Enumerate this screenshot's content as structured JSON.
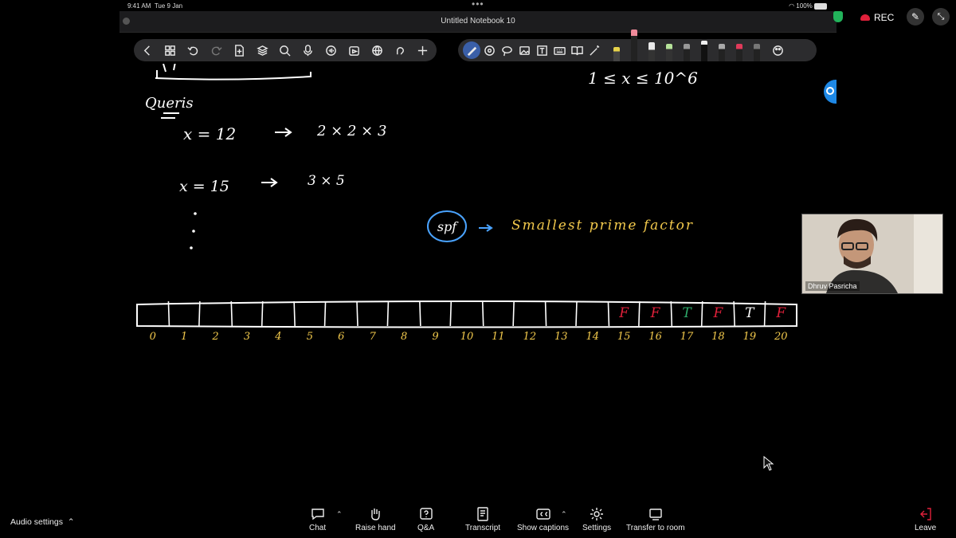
{
  "status_bar": {
    "time": "9:41 AM",
    "date": "Tue 9 Jan",
    "battery": "100%"
  },
  "notebook": {
    "title": "Untitled Notebook 10"
  },
  "handwriting": {
    "constraint": "1 ≤ x ≤ 10^6",
    "queries_label": "Queris",
    "query1_lhs": "x = 12",
    "query1_rhs": "2 × 2 × 3",
    "query2_lhs": "x = 15",
    "query2_rhs": "3 × 5",
    "spf_label": "spf",
    "spf_meaning": "Smallest prime factor",
    "index_labels": [
      "0",
      "1",
      "2",
      "3",
      "4",
      "5",
      "6",
      "7",
      "8",
      "9",
      "10",
      "11",
      "12",
      "13",
      "14",
      "15",
      "16",
      "17",
      "18",
      "19",
      "20"
    ],
    "cell_marks": [
      {
        "cell": 15,
        "text": "F",
        "color": "#e0203a"
      },
      {
        "cell": 16,
        "text": "F",
        "color": "#e0203a"
      },
      {
        "cell": 17,
        "text": "T",
        "color": "#2eaa6a"
      },
      {
        "cell": 18,
        "text": "F",
        "color": "#e0203a"
      },
      {
        "cell": 19,
        "text": "T",
        "color": "#ffffff"
      },
      {
        "cell": 20,
        "text": "F",
        "color": "#e0203a"
      }
    ]
  },
  "zoom": {
    "rec_label": "REC",
    "participant_name": "Dhruv Pasricha",
    "audio_settings": "Audio settings",
    "controls": {
      "chat": "Chat",
      "raise_hand": "Raise hand",
      "qa": "Q&A",
      "transcript": "Transcript",
      "show_captions": "Show captions",
      "settings": "Settings",
      "transfer": "Transfer to room",
      "leave": "Leave"
    }
  },
  "colors": {
    "ink_white": "#ffffff",
    "ink_yellow": "#f2c94c",
    "ink_blue": "#4aa3ff",
    "leave_red": "#e0203a"
  }
}
